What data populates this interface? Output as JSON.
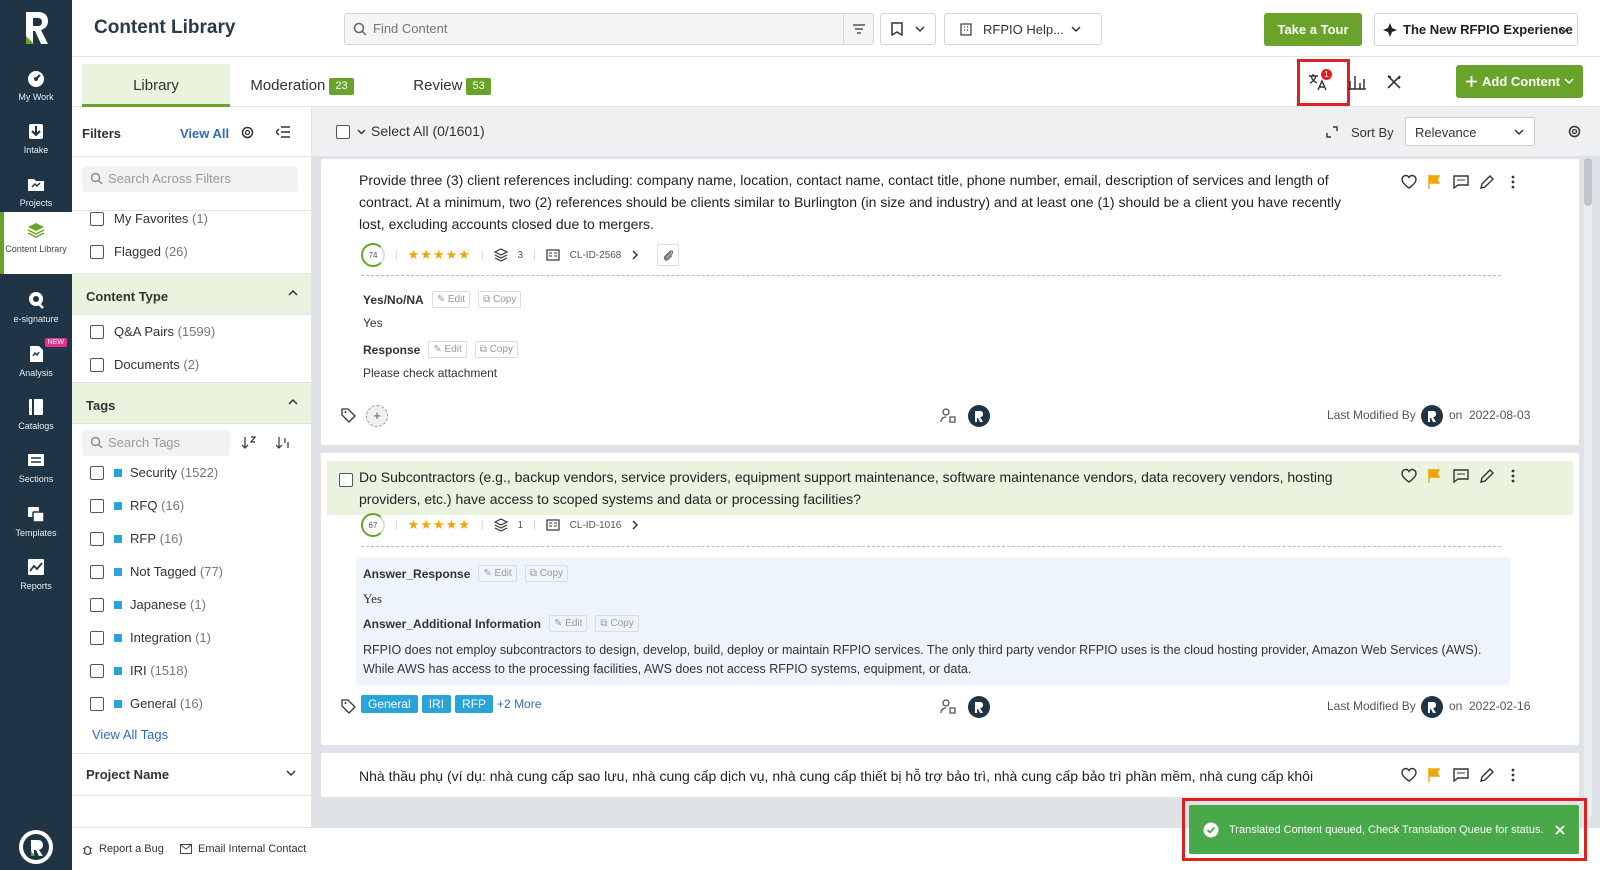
{
  "app": {
    "title": "Content Library"
  },
  "sidenav": {
    "items": [
      {
        "label": "My Work",
        "icon": "dashboard-icon"
      },
      {
        "label": "Intake",
        "icon": "download-icon"
      },
      {
        "label": "Projects",
        "icon": "folder-icon"
      },
      {
        "label": "Content Library",
        "icon": "stack-icon"
      },
      {
        "label": "e-signature",
        "icon": "signature-icon"
      },
      {
        "label": "Analysis",
        "icon": "document-icon",
        "badge": "NEW"
      },
      {
        "label": "Catalogs",
        "icon": "book-icon"
      },
      {
        "label": "Sections",
        "icon": "sections-icon"
      },
      {
        "label": "Templates",
        "icon": "templates-icon"
      },
      {
        "label": "Reports",
        "icon": "chart-icon"
      }
    ]
  },
  "header": {
    "search_placeholder": "Find Content",
    "help_label": "RFPIO Help...",
    "tour_label": "Take a Tour",
    "experience_label": "The New RFPIO Experience"
  },
  "tabs": [
    {
      "label": "Library",
      "badge": ""
    },
    {
      "label": "Moderation",
      "badge": "23"
    },
    {
      "label": "Review",
      "badge": "53"
    }
  ],
  "toolbar": {
    "add_label": "Add Content",
    "translate_badge": "1"
  },
  "filters": {
    "title": "Filters",
    "view_all": "View All",
    "search_placeholder": "Search Across Filters",
    "quick": [
      {
        "label": "My Favorites",
        "count": "(1)"
      },
      {
        "label": "Flagged",
        "count": "(26)"
      }
    ],
    "content_type": {
      "title": "Content Type",
      "items": [
        {
          "label": "Q&A Pairs",
          "count": "(1599)"
        },
        {
          "label": "Documents",
          "count": "(2)"
        }
      ]
    },
    "tags": {
      "title": "Tags",
      "search_placeholder": "Search Tags",
      "items": [
        {
          "label": "Security",
          "count": "(1522)"
        },
        {
          "label": "RFQ",
          "count": "(16)"
        },
        {
          "label": "RFP",
          "count": "(16)"
        },
        {
          "label": "Not Tagged",
          "count": "(77)"
        },
        {
          "label": "Japanese",
          "count": "(1)"
        },
        {
          "label": "Integration",
          "count": "(1)"
        },
        {
          "label": "IRI",
          "count": "(1518)"
        },
        {
          "label": "General",
          "count": "(16)"
        }
      ],
      "view_all": "View All Tags"
    },
    "project_name": "Project Name"
  },
  "list": {
    "select_all": "Select All (0/1601)",
    "sort_by_label": "Sort By",
    "sort_value": "Relevance"
  },
  "cards": [
    {
      "question": "Provide three (3) client references including: company name, location, contact name, contact title, phone number, email, description of services and length of contract. At a minimum, two (2) references should be clients similar to Burlington (in size and industry) and at least one (1) should be a client you have recently lost, excluding accounts closed due to mergers.",
      "score": "74",
      "stars": "★★★★★",
      "versions": "3",
      "id": "CL-ID-2568",
      "fields": [
        {
          "label": "Yes/No/NA",
          "value": "Yes"
        },
        {
          "label": "Response",
          "value": "Please check attachment"
        }
      ],
      "modified_label": "Last Modified By",
      "modified_on": "on",
      "modified_date": "2022-08-03"
    },
    {
      "question": "Do Subcontractors (e.g., backup vendors, service providers, equipment support maintenance, software maintenance vendors, data recovery vendors, hosting providers, etc.) have access to scoped systems and data or processing facilities?",
      "score": "67",
      "stars": "★★★★★",
      "versions": "1",
      "id": "CL-ID-1016",
      "fields": [
        {
          "label": "Answer_Response",
          "value": "Yes"
        },
        {
          "label": "Answer_Additional Information",
          "value": "RFPIO does not employ subcontractors to design, develop, build, deploy or maintain RFPIO services. The only third party vendor RFPIO uses is the cloud hosting provider, Amazon Web Services (AWS). While AWS has access to the processing facilities, AWS does not access RFPIO systems, equipment, or data."
        }
      ],
      "tags": [
        "General",
        "IRI",
        "RFP"
      ],
      "more_tags": "+2 More",
      "modified_label": "Last Modified By",
      "modified_on": "on",
      "modified_date": "2022-02-16"
    },
    {
      "question": "Nhà thầu phụ (ví dụ: nhà cung cấp sao lưu, nhà cung cấp dịch vụ, nhà cung cấp thiết bị hỗ trợ bảo trì, nhà cung cấp bảo trì phần mềm, nhà cung cấp khôi"
    }
  ],
  "field_actions": {
    "edit": "Edit",
    "copy": "Copy"
  },
  "bottombar": {
    "report_bug": "Report a Bug",
    "email_contact": "Email Internal Contact"
  },
  "toast": {
    "message": "Translated Content queued, Check Translation Queue for status."
  },
  "colors": {
    "brand_green": "#6aa329",
    "nav_bg": "#1f3444",
    "tag_blue": "#2aa3d8",
    "toast_green": "#48a84a",
    "highlight_red": "#e02020"
  }
}
